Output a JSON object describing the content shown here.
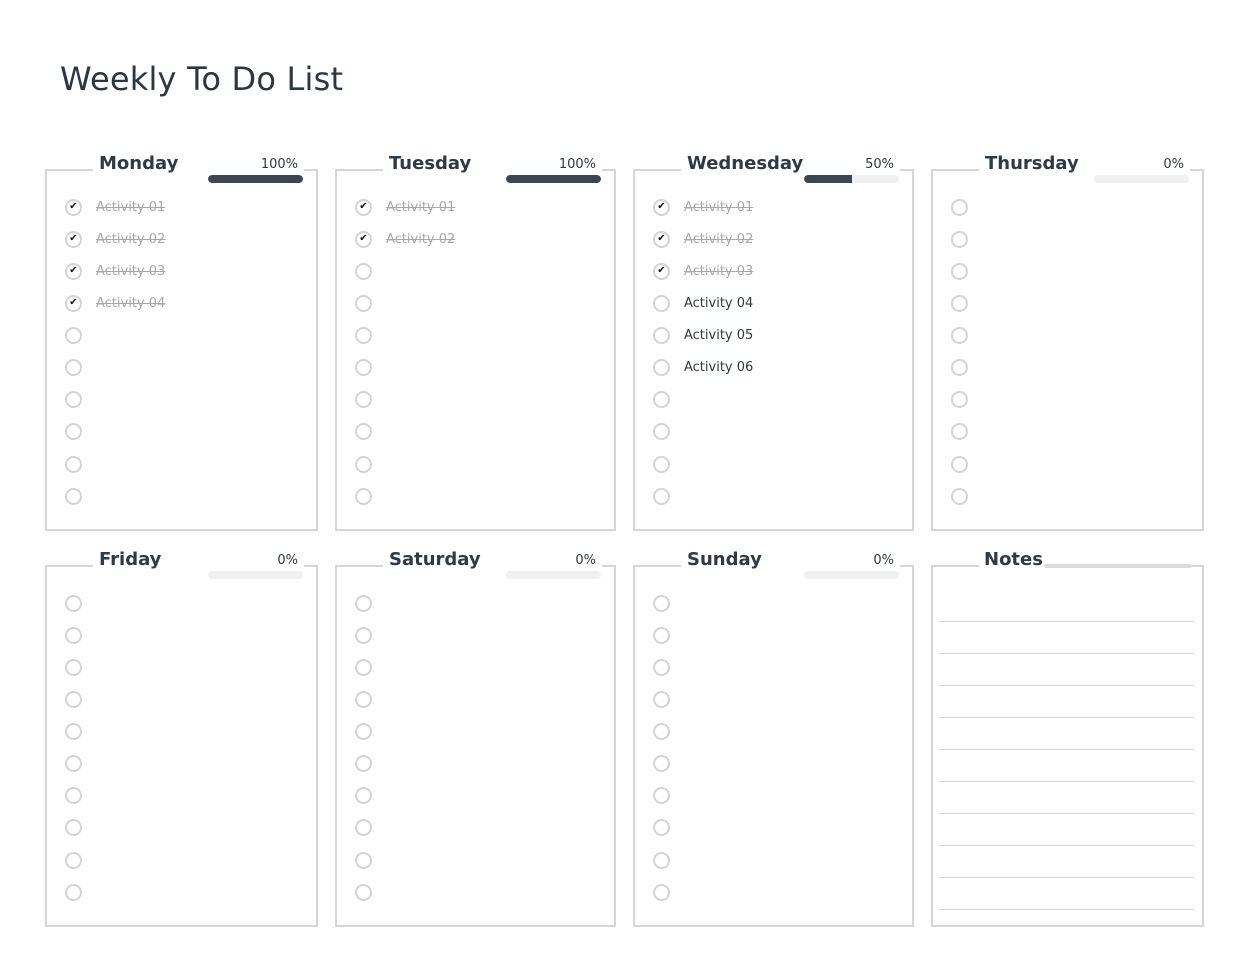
{
  "title": "Weekly To Do List",
  "colors": {
    "accent": "#3c4650",
    "border": "#d6d6d6",
    "track": "#f0f0f0",
    "done_text": "#a8a8a8"
  },
  "days": [
    {
      "name": "Monday",
      "progress_label": "100%",
      "progress": 1.0,
      "items": [
        {
          "label": "Activity 01",
          "done": true
        },
        {
          "label": "Activity 02",
          "done": true
        },
        {
          "label": "Activity 03",
          "done": true
        },
        {
          "label": "Activity 04",
          "done": true
        },
        {
          "label": "",
          "done": false
        },
        {
          "label": "",
          "done": false
        },
        {
          "label": "",
          "done": false
        },
        {
          "label": "",
          "done": false
        },
        {
          "label": "",
          "done": false
        },
        {
          "label": "",
          "done": false
        }
      ]
    },
    {
      "name": "Tuesday",
      "progress_label": "100%",
      "progress": 1.0,
      "items": [
        {
          "label": "Activity 01",
          "done": true
        },
        {
          "label": "Activity 02",
          "done": true
        },
        {
          "label": "",
          "done": false
        },
        {
          "label": "",
          "done": false
        },
        {
          "label": "",
          "done": false
        },
        {
          "label": "",
          "done": false
        },
        {
          "label": "",
          "done": false
        },
        {
          "label": "",
          "done": false
        },
        {
          "label": "",
          "done": false
        },
        {
          "label": "",
          "done": false
        }
      ]
    },
    {
      "name": "Wednesday",
      "progress_label": "50%",
      "progress": 0.5,
      "items": [
        {
          "label": "Activity 01",
          "done": true
        },
        {
          "label": "Activity 02",
          "done": true
        },
        {
          "label": "Activity 03",
          "done": true
        },
        {
          "label": "Activity 04",
          "done": false
        },
        {
          "label": "Activity 05",
          "done": false
        },
        {
          "label": "Activity 06",
          "done": false
        },
        {
          "label": "",
          "done": false
        },
        {
          "label": "",
          "done": false
        },
        {
          "label": "",
          "done": false
        },
        {
          "label": "",
          "done": false
        }
      ]
    },
    {
      "name": "Thursday",
      "progress_label": "0%",
      "progress": 0,
      "items": [
        {
          "label": "",
          "done": false
        },
        {
          "label": "",
          "done": false
        },
        {
          "label": "",
          "done": false
        },
        {
          "label": "",
          "done": false
        },
        {
          "label": "",
          "done": false
        },
        {
          "label": "",
          "done": false
        },
        {
          "label": "",
          "done": false
        },
        {
          "label": "",
          "done": false
        },
        {
          "label": "",
          "done": false
        },
        {
          "label": "",
          "done": false
        }
      ]
    },
    {
      "name": "Friday",
      "progress_label": "0%",
      "progress": 0,
      "items": [
        {
          "label": "",
          "done": false
        },
        {
          "label": "",
          "done": false
        },
        {
          "label": "",
          "done": false
        },
        {
          "label": "",
          "done": false
        },
        {
          "label": "",
          "done": false
        },
        {
          "label": "",
          "done": false
        },
        {
          "label": "",
          "done": false
        },
        {
          "label": "",
          "done": false
        },
        {
          "label": "",
          "done": false
        },
        {
          "label": "",
          "done": false
        }
      ]
    },
    {
      "name": "Saturday",
      "progress_label": "0%",
      "progress": 0,
      "items": [
        {
          "label": "",
          "done": false
        },
        {
          "label": "",
          "done": false
        },
        {
          "label": "",
          "done": false
        },
        {
          "label": "",
          "done": false
        },
        {
          "label": "",
          "done": false
        },
        {
          "label": "",
          "done": false
        },
        {
          "label": "",
          "done": false
        },
        {
          "label": "",
          "done": false
        },
        {
          "label": "",
          "done": false
        },
        {
          "label": "",
          "done": false
        }
      ]
    },
    {
      "name": "Sunday",
      "progress_label": "0%",
      "progress": 0,
      "items": [
        {
          "label": "",
          "done": false
        },
        {
          "label": "",
          "done": false
        },
        {
          "label": "",
          "done": false
        },
        {
          "label": "",
          "done": false
        },
        {
          "label": "",
          "done": false
        },
        {
          "label": "",
          "done": false
        },
        {
          "label": "",
          "done": false
        },
        {
          "label": "",
          "done": false
        },
        {
          "label": "",
          "done": false
        },
        {
          "label": "",
          "done": false
        }
      ]
    }
  ],
  "notes": {
    "title": "Notes",
    "line_count": 10
  },
  "icons": {
    "check": "checkmark-icon",
    "empty": "empty-circle-icon"
  }
}
